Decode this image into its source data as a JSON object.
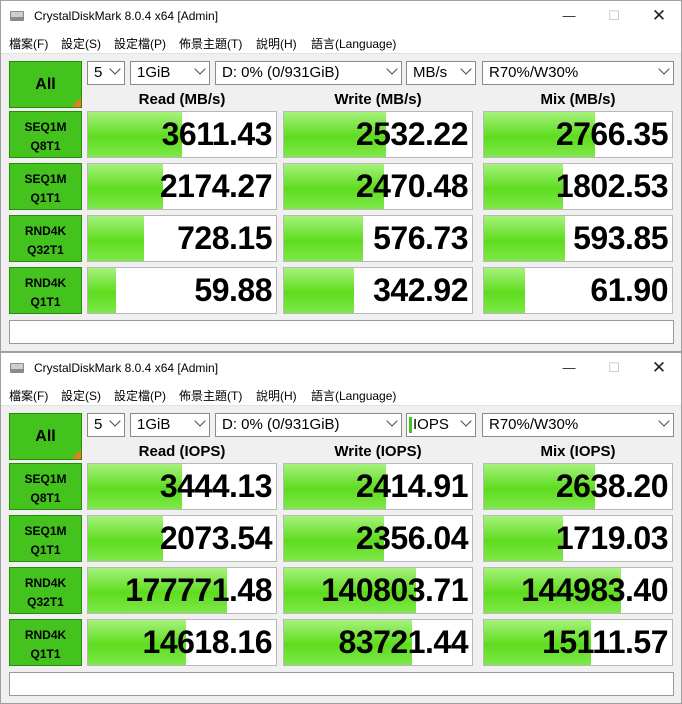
{
  "colors": {
    "accent_green": "#44c21e",
    "fill_green": "#5edc1e",
    "orange_corner": "#f07a1a"
  },
  "windows": [
    {
      "title": "CrystalDiskMark 8.0.4 x64 [Admin]",
      "menu": [
        "檔案(F)",
        "設定(S)",
        "設定檔(P)",
        "佈景主題(T)",
        "說明(H)",
        "語言(Language)"
      ],
      "all_label": "All",
      "count": "5",
      "size": "1GiB",
      "drive": "D: 0% (0/931GiB)",
      "unit": "MB/s",
      "mix": "R70%/W30%",
      "headers": [
        "Read (MB/s)",
        "Write (MB/s)",
        "Mix (MB/s)"
      ],
      "rows": [
        {
          "l1": "SEQ1M",
          "l2": "Q8T1",
          "values": [
            "3611.43",
            "2532.22",
            "2766.35"
          ],
          "fill": [
            0.5,
            0.54,
            0.59
          ]
        },
        {
          "l1": "SEQ1M",
          "l2": "Q1T1",
          "values": [
            "2174.27",
            "2470.48",
            "1802.53"
          ],
          "fill": [
            0.4,
            0.53,
            0.42
          ]
        },
        {
          "l1": "RND4K",
          "l2": "Q32T1",
          "values": [
            "728.15",
            "576.73",
            "593.85"
          ],
          "fill": [
            0.3,
            0.42,
            0.43
          ]
        },
        {
          "l1": "RND4K",
          "l2": "Q1T1",
          "values": [
            "59.88",
            "342.92",
            "61.90"
          ],
          "fill": [
            0.15,
            0.37,
            0.22
          ]
        }
      ],
      "comment": ""
    },
    {
      "title": "CrystalDiskMark 8.0.4 x64 [Admin]",
      "menu": [
        "檔案(F)",
        "設定(S)",
        "設定檔(P)",
        "佈景主題(T)",
        "說明(H)",
        "語言(Language)"
      ],
      "all_label": "All",
      "count": "5",
      "size": "1GiB",
      "drive": "D: 0% (0/931GiB)",
      "unit": "IOPS",
      "mix": "R70%/W30%",
      "headers": [
        "Read (IOPS)",
        "Write (IOPS)",
        "Mix (IOPS)"
      ],
      "rows": [
        {
          "l1": "SEQ1M",
          "l2": "Q8T1",
          "values": [
            "3444.13",
            "2414.91",
            "2638.20"
          ],
          "fill": [
            0.5,
            0.54,
            0.59
          ]
        },
        {
          "l1": "SEQ1M",
          "l2": "Q1T1",
          "values": [
            "2073.54",
            "2356.04",
            "1719.03"
          ],
          "fill": [
            0.4,
            0.53,
            0.42
          ]
        },
        {
          "l1": "RND4K",
          "l2": "Q32T1",
          "values": [
            "177771.48",
            "140803.71",
            "144983.40"
          ],
          "fill": [
            0.74,
            0.7,
            0.73
          ]
        },
        {
          "l1": "RND4K",
          "l2": "Q1T1",
          "values": [
            "14618.16",
            "83721.44",
            "15111.57"
          ],
          "fill": [
            0.52,
            0.68,
            0.57
          ]
        }
      ],
      "comment": ""
    }
  ]
}
